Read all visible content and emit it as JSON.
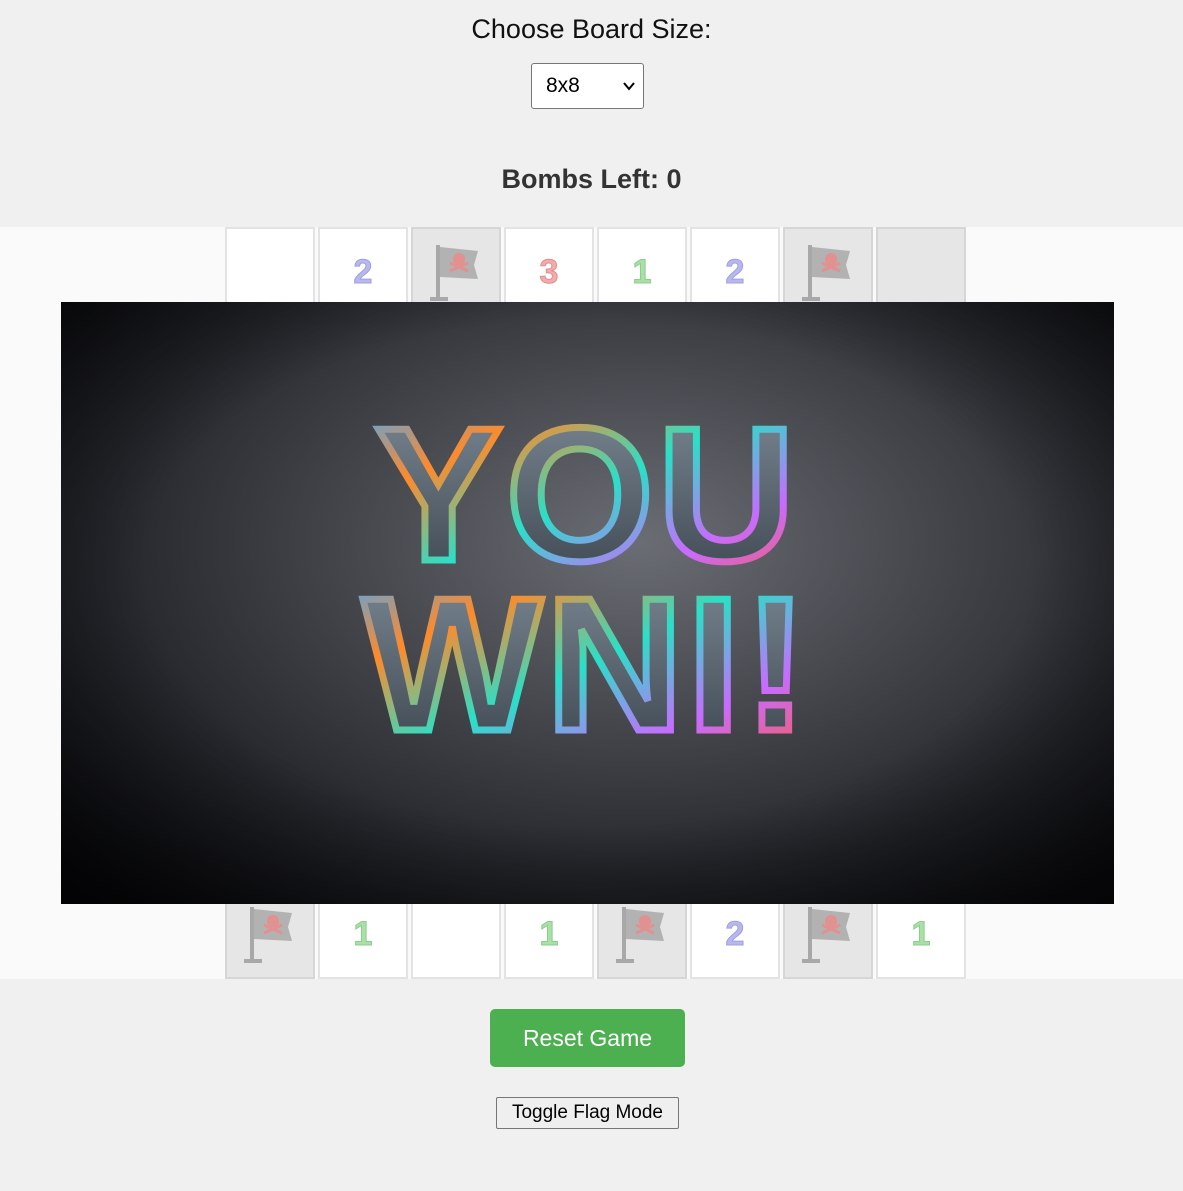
{
  "header": {
    "title": "Choose Board Size:"
  },
  "board_size": {
    "selected": "8x8"
  },
  "status": {
    "bombs_left_text": "Bombs Left: 0"
  },
  "board": {
    "top_row": [
      {
        "state": "open",
        "value": ""
      },
      {
        "state": "open",
        "value": "2"
      },
      {
        "state": "flag",
        "value": ""
      },
      {
        "state": "open",
        "value": "3"
      },
      {
        "state": "open",
        "value": "1"
      },
      {
        "state": "open",
        "value": "2"
      },
      {
        "state": "flag",
        "value": ""
      },
      {
        "state": "hidden",
        "value": ""
      }
    ],
    "bottom_row": [
      {
        "state": "flag",
        "value": ""
      },
      {
        "state": "open",
        "value": "1"
      },
      {
        "state": "open",
        "value": ""
      },
      {
        "state": "open",
        "value": "1"
      },
      {
        "state": "flag",
        "value": ""
      },
      {
        "state": "open",
        "value": "2"
      },
      {
        "state": "flag",
        "value": ""
      },
      {
        "state": "open",
        "value": "1"
      }
    ],
    "flag_icon": "pirate-flag-icon"
  },
  "win_overlay": {
    "line1": "YOU",
    "line2": "WNI!"
  },
  "controls": {
    "reset_label": "Reset Game",
    "toggle_flag_label": "Toggle Flag Mode",
    "reset_color": "#4caf50"
  }
}
